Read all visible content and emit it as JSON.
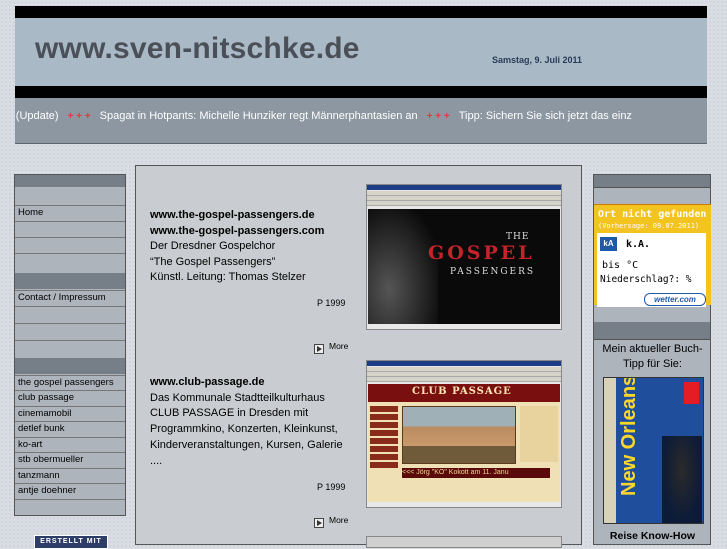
{
  "header": {
    "site_title": "www.sven-nitschke.de",
    "date": "Samstag, 9. Juli 2011"
  },
  "ticker": {
    "items": [
      "rt (Update)",
      "Spagat in Hotpants: Michelle Hunziker regt Männerphantasien an",
      "Tipp: Sichern Sie sich jetzt das einz"
    ],
    "separator": "+ + +"
  },
  "leftnav": {
    "items": [
      "Home",
      "Contact / Impressum",
      "the gospel passengers",
      "club passage",
      "cinemamobil",
      "detlef bunk",
      "ko-art",
      "stb obermueller",
      "tanzmann",
      "antje doehner"
    ]
  },
  "entries": [
    {
      "url1": "www.the-gospel-passengers.de",
      "url2": "www.the-gospel-passengers.com",
      "lines": [
        "Der Dresdner Gospelchor",
        "“The Gospel Passengers”",
        "Künstl. Leitung: Thomas Stelzer"
      ],
      "year": "P 1999",
      "more": "More"
    },
    {
      "url1": "www.club-passage.de",
      "lines": [
        "Das Kommunale Stadtteilkulturhaus",
        "CLUB PASSAGE in Dresden mit",
        "Programmkino, Konzerten, Kleinkunst,",
        "Kinderveranstaltungen, Kursen, Galerie",
        "...."
      ],
      "year": "P 1999",
      "more": "More"
    }
  ],
  "screenshots": {
    "gospel": {
      "the": "THE",
      "main": "GOSPEL",
      "sub": "PASSENGERS"
    },
    "club": {
      "title": "CLUB PASSAGE",
      "ticker": "<<< Jörg \"KO\" Kokott am 11. Janu"
    }
  },
  "weather": {
    "title": "Ort nicht gefunden",
    "subtitle": "(Vorhersage: 09.07.2011)",
    "icon": "kA",
    "condition": "k.A.",
    "temp": "bis  °C",
    "rain": "Niederschlag?: %",
    "logo": "wetter.com"
  },
  "book": {
    "title": "Mein aktueller Buch-Tipp für Sie:",
    "cover_city": "New Orleans",
    "caption": "Reise Know-How"
  },
  "badge": {
    "label": "ERSTELLT MIT"
  }
}
